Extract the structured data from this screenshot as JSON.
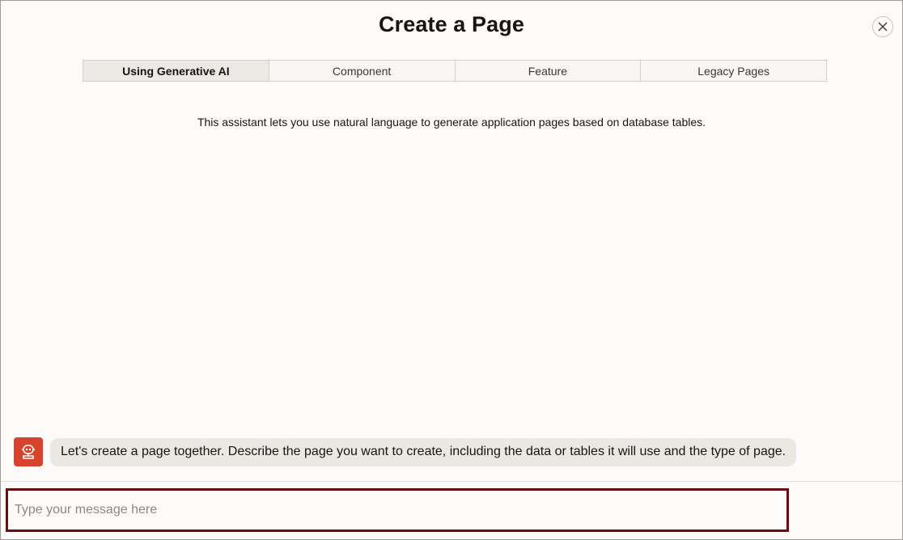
{
  "dialog": {
    "title": "Create a Page",
    "close_icon": "close-icon"
  },
  "tabs": [
    {
      "label": "Using Generative AI",
      "active": true
    },
    {
      "label": "Component",
      "active": false
    },
    {
      "label": "Feature",
      "active": false
    },
    {
      "label": "Legacy Pages",
      "active": false
    }
  ],
  "intro_text": "This assistant lets you use natural language to generate application pages based on database tables.",
  "chat": {
    "bot_icon": "robot-icon",
    "bot_color": "#d8432e",
    "messages": [
      {
        "from": "assistant",
        "text": "Let's create a page together. Describe the page you want to create, including the data or tables it will use and the type of page."
      }
    ]
  },
  "composer": {
    "placeholder": "Type your message here",
    "value": "",
    "focus_border_color": "#6e0b12"
  }
}
